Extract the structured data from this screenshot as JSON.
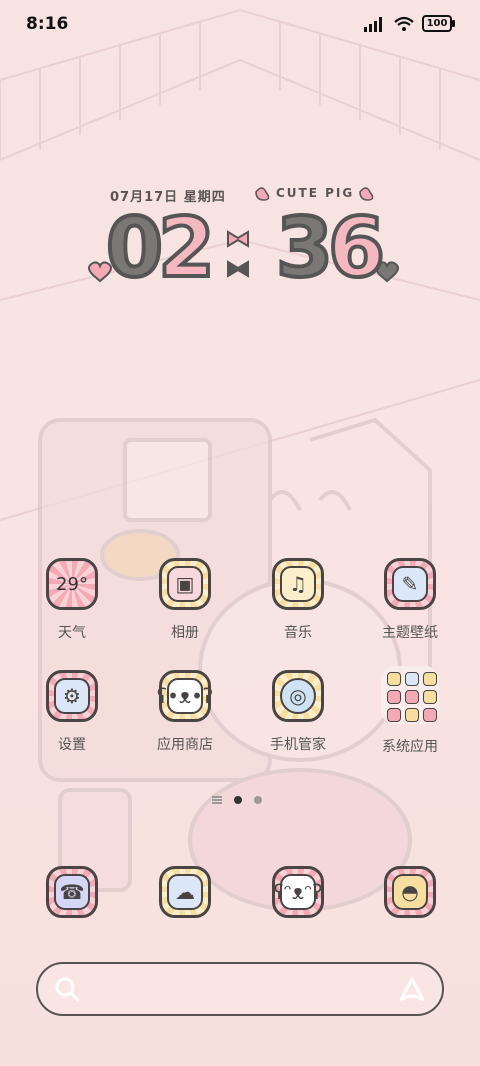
{
  "status_bar": {
    "time": "8:16",
    "battery": "100"
  },
  "widget": {
    "date": "07月17日 星期四",
    "tag": "CUTE PIG",
    "hour_1": "0",
    "hour_2": "2",
    "min_1": "3",
    "min_2": "6"
  },
  "apps_row1": [
    {
      "name": "天气",
      "extra": "29°",
      "icon": "weather-icon"
    },
    {
      "name": "相册",
      "icon": "gallery-icon"
    },
    {
      "name": "音乐",
      "icon": "music-icon"
    },
    {
      "name": "主题壁纸",
      "icon": "theme-brush-icon"
    }
  ],
  "apps_row2": [
    {
      "name": "设置",
      "icon": "settings-icon"
    },
    {
      "name": "应用商店",
      "icon": "store-bear-icon"
    },
    {
      "name": "手机管家",
      "icon": "security-icon"
    },
    {
      "name": "系统应用",
      "icon": "folder-icon"
    }
  ],
  "dock": [
    {
      "icon": "phone-icon"
    },
    {
      "icon": "messages-icon"
    },
    {
      "icon": "camera-dog-icon"
    },
    {
      "icon": "browser-icon"
    }
  ],
  "colors": {
    "accent_pink": "#f4a9b6",
    "accent_yellow": "#f5dea0",
    "outline": "#4a4444"
  }
}
